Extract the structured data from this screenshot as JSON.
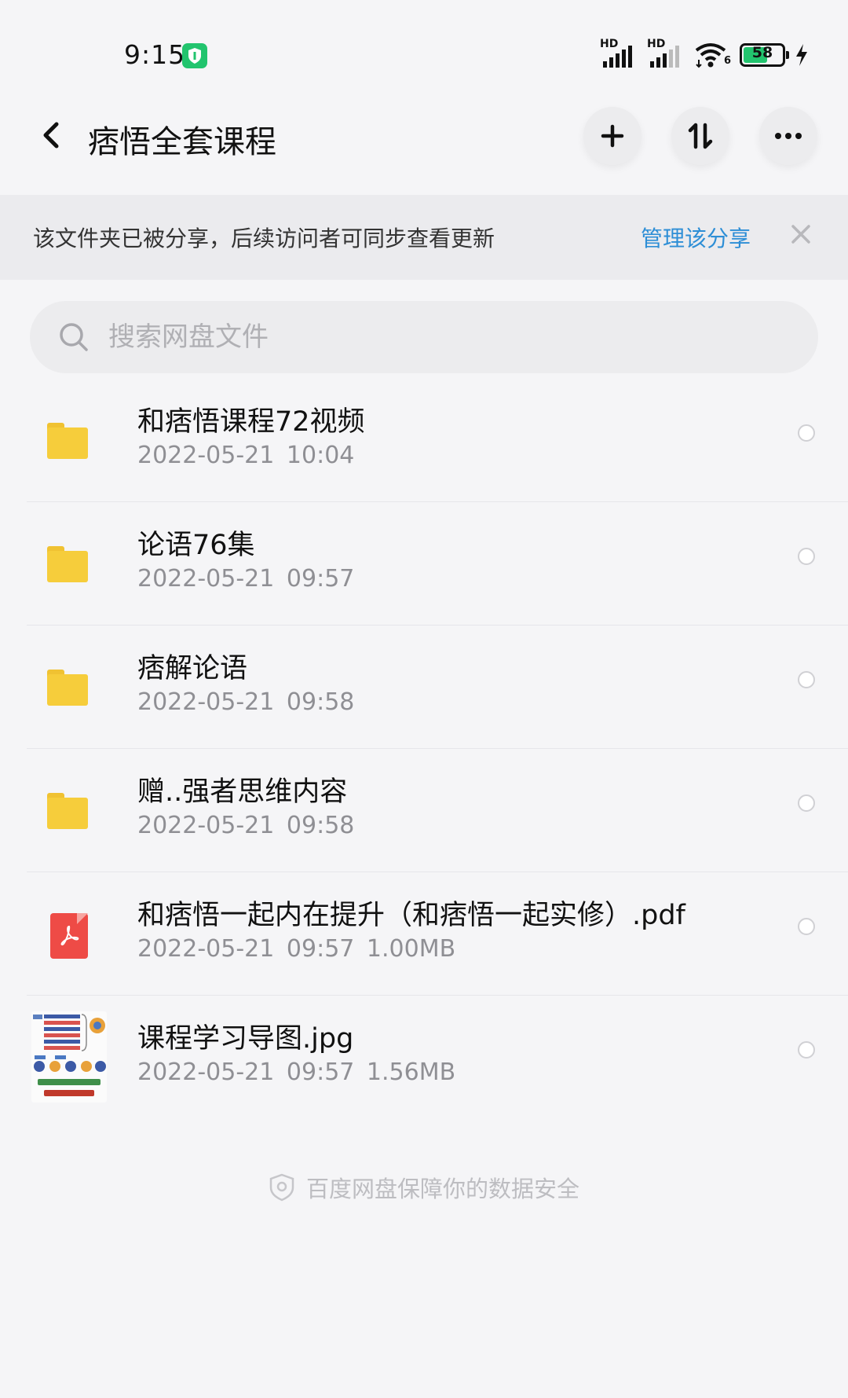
{
  "status_bar": {
    "time": "9:15",
    "battery_level": "58",
    "signal_1_label": "HD",
    "signal_2_label": "HD",
    "wifi_label": "6",
    "icons": [
      "vpn-shield-icon",
      "signal-icon",
      "wifi-icon",
      "battery-icon",
      "charging-icon"
    ]
  },
  "header": {
    "title": "痞悟全套课程",
    "back_icon": "chevron-left-icon",
    "add_icon": "plus-icon",
    "sort_icon": "sort-icon",
    "more_icon": "more-icon"
  },
  "share_banner": {
    "text": "该文件夹已被分享，后续访问者可同步查看更新",
    "action": "管理该分享",
    "close_icon": "close-icon"
  },
  "search": {
    "placeholder": "搜索网盘文件",
    "value": ""
  },
  "files": [
    {
      "name": "和痞悟课程72视频",
      "date": "2022-05-21",
      "time": "10:04",
      "size": "",
      "type": "folder"
    },
    {
      "name": "论语76集",
      "date": "2022-05-21",
      "time": "09:57",
      "size": "",
      "type": "folder"
    },
    {
      "name": "痞解论语",
      "date": "2022-05-21",
      "time": "09:58",
      "size": "",
      "type": "folder"
    },
    {
      "name": "赠..强者思维内容",
      "date": "2022-05-21",
      "time": "09:58",
      "size": "",
      "type": "folder"
    },
    {
      "name": "和痞悟一起内在提升（和痞悟一起实修）.pdf",
      "date": "2022-05-21",
      "time": "09:57",
      "size": "1.00MB",
      "type": "pdf"
    },
    {
      "name": "课程学习导图.jpg",
      "date": "2022-05-21",
      "time": "09:57",
      "size": "1.56MB",
      "type": "image"
    }
  ],
  "footer": {
    "text": "百度网盘保障你的数据安全"
  },
  "colors": {
    "background": "#f5f5f7",
    "banner": "#ebebee",
    "link": "#2d8ed6",
    "folder": "#f6cd3b",
    "pdf": "#ee4b46",
    "battery": "#22c46e"
  }
}
